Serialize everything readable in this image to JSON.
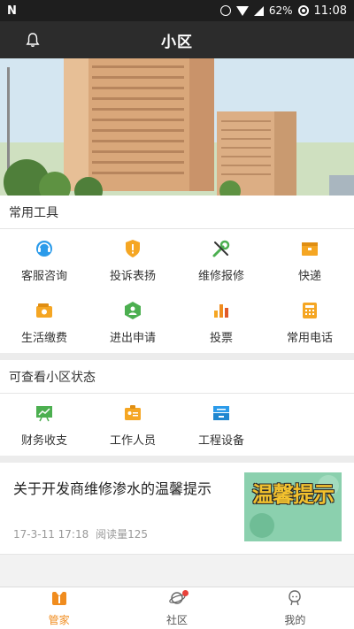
{
  "status_bar": {
    "battery": "62%",
    "time": "11:08"
  },
  "header": {
    "title": "小区",
    "bell_icon": "bell-icon"
  },
  "tools": {
    "heading": "常用工具",
    "items": [
      {
        "label": "客服咨询",
        "icon": "headset-icon",
        "color": "#2b9bea"
      },
      {
        "label": "投诉表扬",
        "icon": "shield-warning-icon",
        "color": "#f5a623"
      },
      {
        "label": "维修报修",
        "icon": "tools-icon",
        "color": "#4caf50"
      },
      {
        "label": "快递",
        "icon": "package-icon",
        "color": "#f5a623"
      },
      {
        "label": "生活缴费",
        "icon": "wallet-icon",
        "color": "#f5a623"
      },
      {
        "label": "进出申请",
        "icon": "pass-icon",
        "color": "#4caf50"
      },
      {
        "label": "投票",
        "icon": "bar-chart-icon",
        "color": "#f08c1e"
      },
      {
        "label": "常用电话",
        "icon": "phone-icon",
        "color": "#f5a623"
      }
    ]
  },
  "status_section": {
    "heading": "可查看小区状态",
    "items": [
      {
        "label": "财务收支",
        "icon": "finance-board-icon",
        "color": "#4caf50"
      },
      {
        "label": "工作人员",
        "icon": "staff-badge-icon",
        "color": "#f5a623"
      },
      {
        "label": "工程设备",
        "icon": "equipment-icon",
        "color": "#2b9bea"
      }
    ]
  },
  "article": {
    "headline": "关于开发商维修渗水的温馨提示",
    "date": "17-3-11 17:18",
    "reads": "阅读量125",
    "thumb_text": "温馨提示"
  },
  "tabbar": {
    "tabs": [
      {
        "label": "管家",
        "icon": "housekeeper-icon",
        "active": true
      },
      {
        "label": "社区",
        "icon": "planet-icon",
        "active": false
      },
      {
        "label": "我的",
        "icon": "profile-icon",
        "active": false
      }
    ]
  },
  "colors": {
    "accent": "#f08c1e",
    "titlebar": "#2c2c2c",
    "notification_dot": "#e8413a"
  }
}
